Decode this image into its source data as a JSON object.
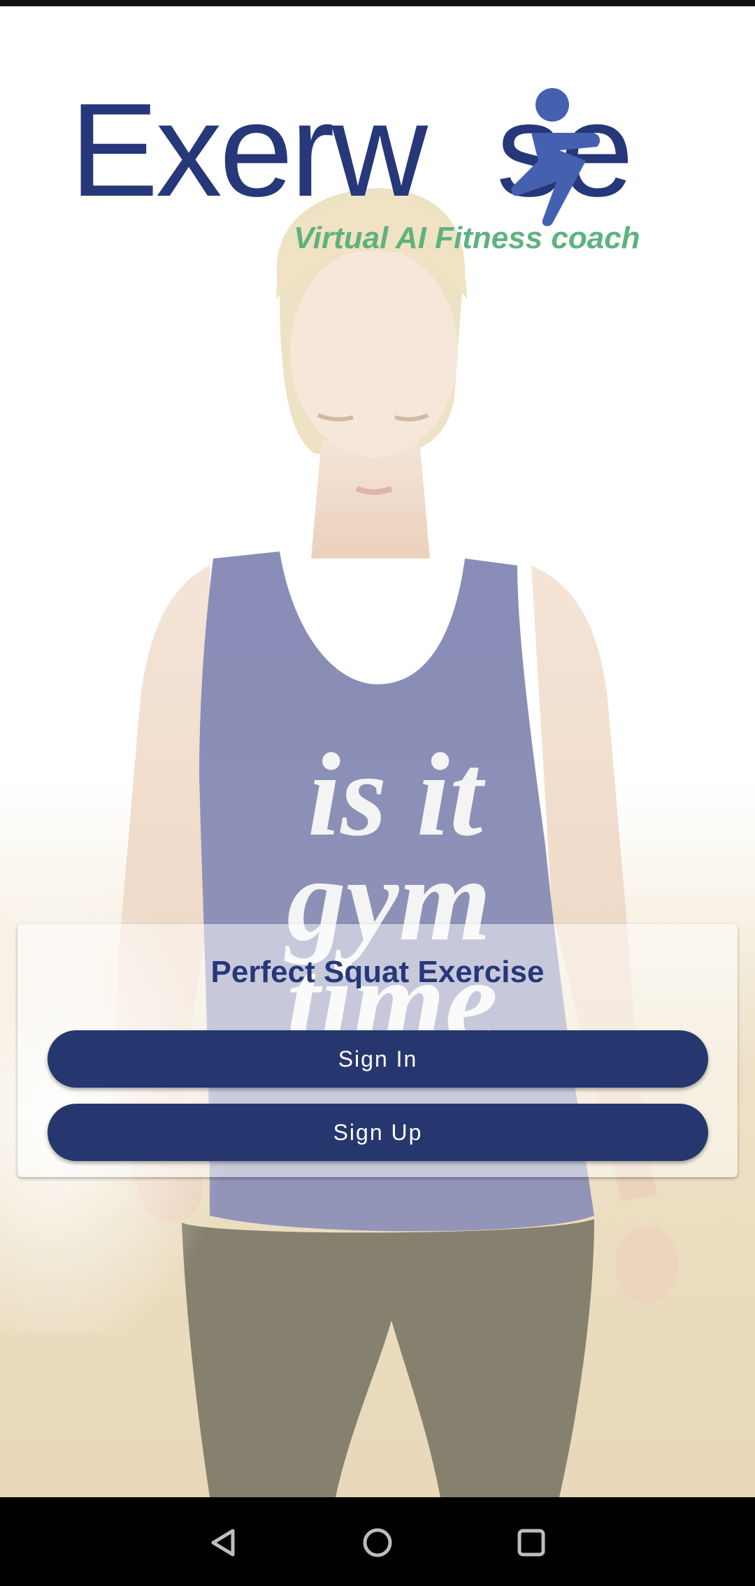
{
  "app": {
    "logo_text_start": "Exerw",
    "logo_text_end": "se",
    "tagline": "Virtual AI Fitness coach",
    "brand_color": "#26377a",
    "tagline_color": "#5fb27f",
    "figure_color": "#4660b0"
  },
  "hero": {
    "shirt_text": "is it gym time"
  },
  "card": {
    "title": "Perfect Squat Exercise",
    "signin_label": "Sign In",
    "signup_label": "Sign Up",
    "button_color": "#26366e"
  },
  "navbar": {
    "back_icon": "triangle-back-icon",
    "home_icon": "circle-home-icon",
    "recents_icon": "square-recents-icon"
  }
}
